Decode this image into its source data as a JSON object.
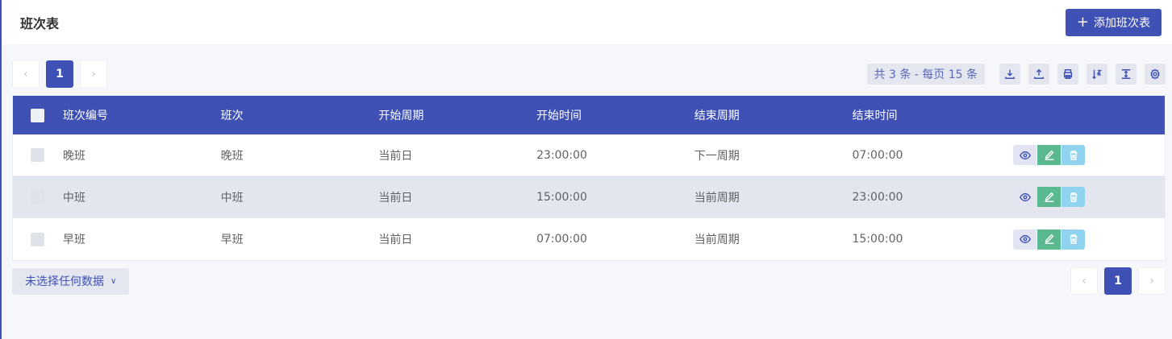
{
  "header": {
    "title": "班次表",
    "add_button_label": "添加班次表",
    "add_icon": "plus-icon"
  },
  "pagination": {
    "prev_icon": "chevron-left-icon",
    "next_icon": "chevron-right-icon",
    "current_page": "1"
  },
  "toolbar": {
    "total_info": "共 3 条 - 每页 15 条",
    "tools": [
      "download-icon",
      "upload-icon",
      "print-icon",
      "sort-icon",
      "column-height-icon",
      "settings-icon"
    ]
  },
  "table": {
    "columns": [
      "班次编号",
      "班次",
      "开始周期",
      "开始时间",
      "结束周期",
      "结束时间"
    ],
    "rows": [
      {
        "code": "晚班",
        "shift": "晚班",
        "start_cycle": "当前日",
        "start_time": "23:00:00",
        "end_cycle": "下一周期",
        "end_time": "07:00:00"
      },
      {
        "code": "中班",
        "shift": "中班",
        "start_cycle": "当前日",
        "start_time": "15:00:00",
        "end_cycle": "当前周期",
        "end_time": "23:00:00"
      },
      {
        "code": "早班",
        "shift": "早班",
        "start_cycle": "当前日",
        "start_time": "07:00:00",
        "end_cycle": "当前周期",
        "end_time": "15:00:00"
      }
    ]
  },
  "footer": {
    "selection_label": "未选择任何数据",
    "current_page": "1"
  },
  "colors": {
    "primary": "#3f51b5",
    "edit": "#5ab98f",
    "delete": "#8fd3ee"
  }
}
